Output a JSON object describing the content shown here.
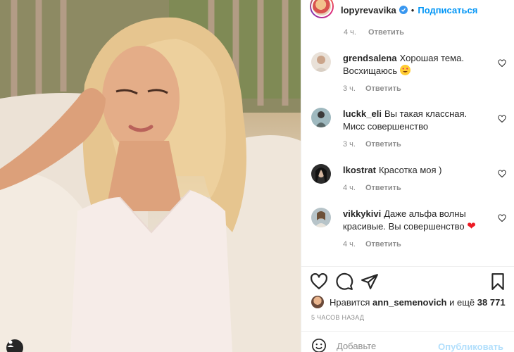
{
  "post": {
    "author": "lopyrevavika",
    "follow_label": "Подписаться",
    "separator": "•",
    "top_meta": {
      "time": "4 ч.",
      "reply": "Ответить"
    }
  },
  "comments": [
    {
      "user": "grendsalena",
      "text": "Хорошая тема. Восхищаюсь",
      "emoji": "smiling-face-with-heart-eyes",
      "time": "3 ч.",
      "reply": "Ответить"
    },
    {
      "user": "luckk_eli",
      "text": "Вы такая классная. Мисс совершенство",
      "time": "3 ч.",
      "reply": "Ответить"
    },
    {
      "user": "lkostrat",
      "text": "Красотка моя )",
      "time": "4 ч.",
      "reply": "Ответить"
    },
    {
      "user": "vikkykivi",
      "text": "Даже альфа волны красивые. Вы совершенство",
      "emoji": "red-heart",
      "heart_char": "❤",
      "time": "4 ч.",
      "reply": "Ответить"
    }
  ],
  "likes": {
    "prefix": "Нравится",
    "user": "ann_semenovich",
    "middle": "и ещё",
    "count": "38 771"
  },
  "post_time": "5 ЧАСОВ НАЗАД",
  "add_comment": {
    "placeholder": "Добавьте",
    "publish_label": "Опубликовать"
  },
  "colors": {
    "accent": "#0095f6",
    "publish_disabled": "#b2dffc",
    "secondary_text": "#8e8e8e",
    "heart_emoji": "#ed1b24",
    "verified": "#3897f0"
  }
}
